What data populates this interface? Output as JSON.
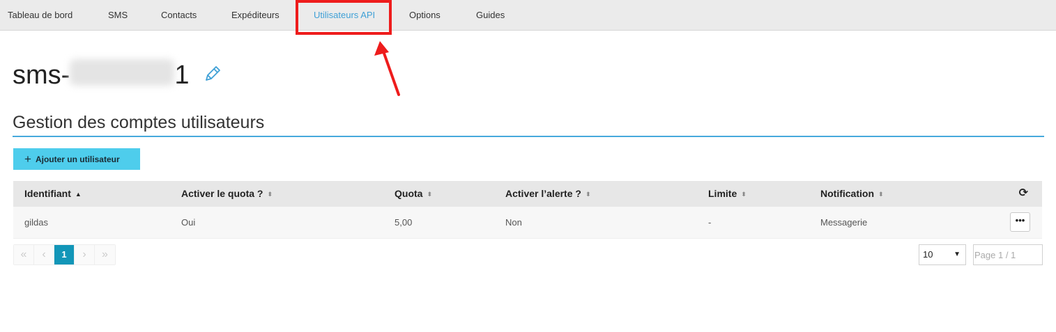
{
  "nav": {
    "tabs": [
      {
        "label": "Tableau de bord"
      },
      {
        "label": "SMS"
      },
      {
        "label": "Contacts"
      },
      {
        "label": "Expéditeurs"
      },
      {
        "label": "Utilisateurs API",
        "active": true
      },
      {
        "label": "Options"
      },
      {
        "label": "Guides"
      }
    ]
  },
  "page": {
    "title_prefix": "sms-",
    "title_suffix": "1",
    "section_title": "Gestion des comptes utilisateurs"
  },
  "actions": {
    "add_user_label": "Ajouter un utilisateur"
  },
  "table": {
    "headers": [
      "Identifiant",
      "Activer le quota ?",
      "Quota",
      "Activer l’alerte ?",
      "Limite",
      "Notification"
    ],
    "sorted_column": "Identifiant",
    "rows": [
      {
        "identifiant": "gildas",
        "quota_active": "Oui",
        "quota": "5,00",
        "alerte": "Non",
        "limite": "-",
        "notification": "Messagerie"
      }
    ],
    "row_menu_label": "•••"
  },
  "pagination": {
    "first": "«",
    "prev": "‹",
    "current": "1",
    "next": "›",
    "last": "»",
    "per_page": "10",
    "page_placeholder": "Page 1 / 1"
  },
  "colors": {
    "accent": "#46a9dc",
    "button": "#4ecdec",
    "active_tab": "#3fa0d6",
    "highlight": "#ee1c1c",
    "page_active": "#1296b8"
  }
}
